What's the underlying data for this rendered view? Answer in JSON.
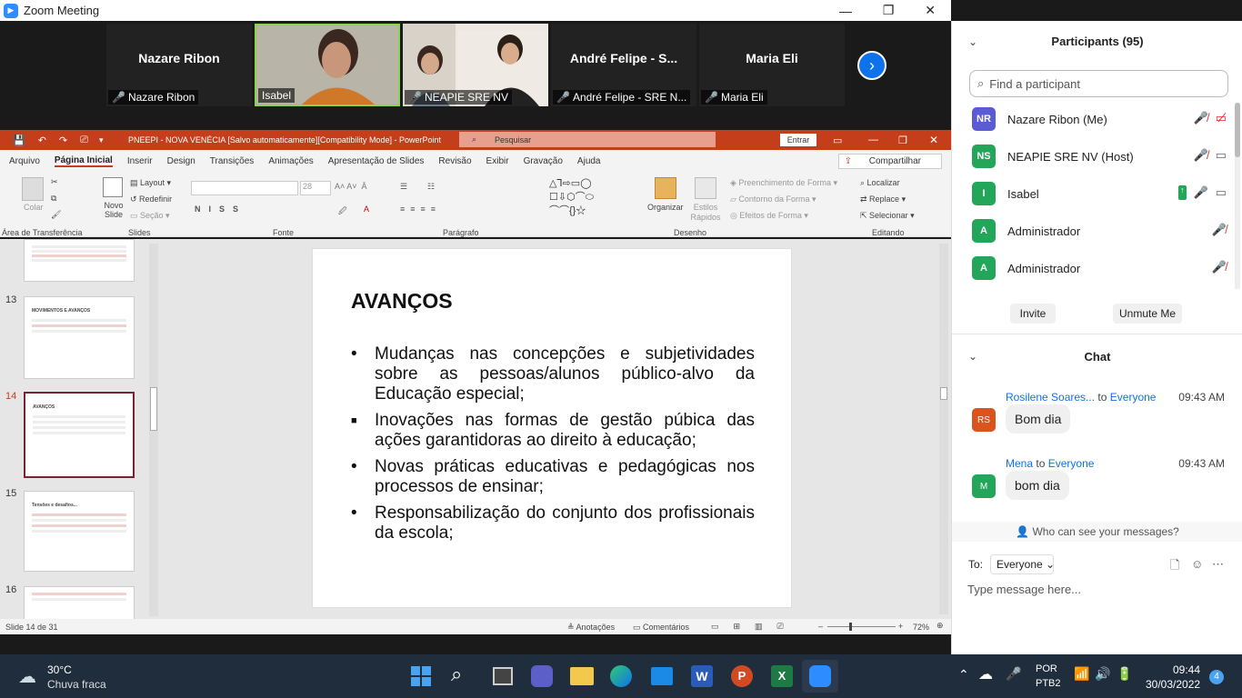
{
  "zoom": {
    "window_title": "Zoom Meeting",
    "controls": {
      "minimize": "—",
      "restore": "❐",
      "close": "✕"
    },
    "tiles": [
      {
        "name": "Nazare Ribon",
        "label": "Nazare Ribon",
        "muted": true
      },
      {
        "name": "",
        "label": "Isabel",
        "muted": false
      },
      {
        "name": "",
        "label": "NEAPIE SRE NV",
        "muted": true
      },
      {
        "name": "André Felipe - S...",
        "label": "André Felipe - SRE N...",
        "muted": true
      },
      {
        "name": "Maria Eli",
        "label": "Maria Eli",
        "muted": true
      }
    ]
  },
  "ppt": {
    "title_text": "PNEEPI - NOVA VENÉCIA [Salvo automaticamente][Compatibility Mode]  -  PowerPoint",
    "search_placeholder": "Pesquisar",
    "enter_label": "Entrar",
    "tabs": [
      "Arquivo",
      "Página Inicial",
      "Inserir",
      "Design",
      "Transições",
      "Animações",
      "Apresentação de Slides",
      "Revisão",
      "Exibir",
      "Gravação",
      "Ajuda"
    ],
    "share_label": "Compartilhar",
    "ribbon": {
      "colar": "Colar",
      "novo_slide": "Novo Slide",
      "layout": "Layout",
      "redefinir": "Redefinir",
      "secao": "Seção",
      "organizar": "Organizar",
      "estilos_rapidos": "Estilos Rápidos",
      "preenchimento": "Preenchimento de Forma",
      "contorno": "Contorno da Forma",
      "efeitos": "Efeitos de Forma",
      "localizar": "Localizar",
      "replace": "Replace",
      "selecionar": "Selecionar",
      "font_size": "28",
      "groups": [
        "Área de Transferência",
        "Slides",
        "Fonte",
        "Parágrafo",
        "Desenho",
        "Editando"
      ]
    },
    "thumbs": [
      {
        "num": "13",
        "title": "MOVIMENTOS E AVANÇOS"
      },
      {
        "num": "14",
        "title": "AVANÇOS"
      },
      {
        "num": "15",
        "title": "Tensões e desafios..."
      },
      {
        "num": "16",
        "title": ""
      }
    ],
    "slide": {
      "title": "AVANÇOS",
      "bullets": [
        "Mudanças nas concepções e subjetividades sobre as pessoas/alunos público-alvo da Educação especial;",
        "Inovações nas formas de gestão púbica das ações garantidoras ao direito à educação;",
        "Novas práticas educativas e pedagógicas nos processos de ensinar;",
        "Responsabilização do conjunto dos profissionais da escola;"
      ]
    },
    "status": {
      "slide_of": "Slide 14 de 31",
      "anotacoes": "Anotações",
      "comentarios": "Comentários",
      "zoom": "72%"
    }
  },
  "panel": {
    "participants_title": "Participants (95)",
    "search_placeholder": "Find a participant",
    "participants": [
      {
        "initials": "NR",
        "name": "Nazare Ribon (Me)",
        "color": "#5b5bd6"
      },
      {
        "initials": "NS",
        "name": "NEAPIE SRE NV  (Host)",
        "color": "#23a55a"
      },
      {
        "initials": "I",
        "name": "Isabel",
        "color": "#23a55a"
      },
      {
        "initials": "A",
        "name": "Administrador",
        "color": "#23a55a"
      },
      {
        "initials": "A",
        "name": "Administrador",
        "color": "#23a55a"
      }
    ],
    "invite": "Invite",
    "unmute": "Unmute Me",
    "chat_title": "Chat",
    "messages": [
      {
        "initials": "RS",
        "from": "Rosilene Soares...",
        "to": "Everyone",
        "time": "09:43 AM",
        "text": "Bom dia",
        "color": "#d9541e"
      },
      {
        "initials": "M",
        "from": "Mena",
        "to": "Everyone",
        "time": "09:43 AM",
        "text": "bom dia",
        "color": "#23a55a"
      }
    ],
    "who_can_see": "Who can see your messages?",
    "to_label": "To:",
    "to_value": "Everyone",
    "type_placeholder": "Type message here..."
  },
  "taskbar": {
    "temp": "30°C",
    "weather": "Chuva fraca",
    "lang": "POR",
    "layout": "PTB2",
    "time": "09:44",
    "date": "30/03/2022",
    "notifications": "4"
  }
}
